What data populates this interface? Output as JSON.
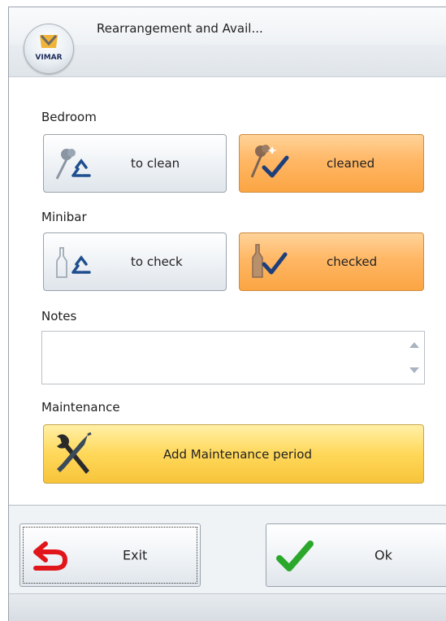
{
  "window": {
    "title": "Rearrangement and Avail...",
    "logo_text": "VIMAR"
  },
  "bedroom": {
    "label": "Bedroom",
    "to_clean": {
      "label": "to clean",
      "icon": "broom-recycle-icon"
    },
    "cleaned": {
      "label": "cleaned",
      "icon": "broom-check-icon",
      "selected": true
    }
  },
  "minibar": {
    "label": "Minibar",
    "to_check": {
      "label": "to check",
      "icon": "bottle-recycle-icon"
    },
    "checked": {
      "label": "checked",
      "icon": "bottle-check-icon",
      "selected": true
    }
  },
  "notes": {
    "label": "Notes",
    "value": ""
  },
  "maintenance": {
    "label": "Maintenance",
    "button_label": "Add Maintenance period",
    "icon": "tools-icon"
  },
  "footer": {
    "exit_label": "Exit",
    "ok_label": "Ok"
  },
  "colors": {
    "selected": "#ffb765",
    "gold": "#ffd85a",
    "check": "#2ba82b",
    "exit_arrow": "#e0161b"
  }
}
